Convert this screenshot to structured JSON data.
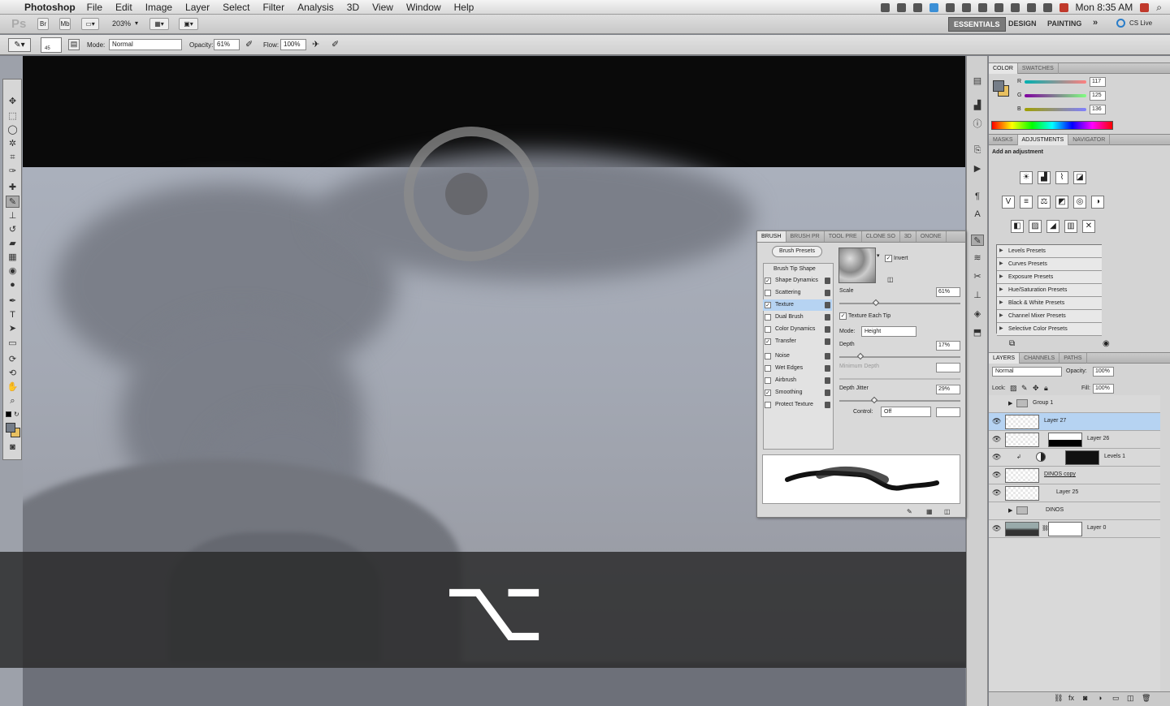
{
  "menubar": {
    "app": "Photoshop",
    "items": [
      "File",
      "Edit",
      "Image",
      "Layer",
      "Select",
      "Filter",
      "Analysis",
      "3D",
      "View",
      "Window",
      "Help"
    ],
    "clock": "Mon 8:35 AM"
  },
  "appbar": {
    "logo": "Ps",
    "br": "Br",
    "mb": "Mb",
    "zoom": "203%",
    "workspaces": [
      "ESSENTIALS",
      "DESIGN",
      "PAINTING"
    ],
    "more": "»",
    "cslive": "CS Live"
  },
  "options": {
    "brush_size": "45",
    "mode_label": "Mode:",
    "mode_value": "Normal",
    "opacity_label": "Opacity:",
    "opacity_value": "61%",
    "flow_label": "Flow:",
    "flow_value": "100%"
  },
  "key_overlay": {
    "glyph": "⌥"
  },
  "color_panel": {
    "tabs": [
      "COLOR",
      "SWATCHES"
    ],
    "r_label": "R",
    "r_value": "117",
    "g_label": "G",
    "g_value": "125",
    "b_label": "B",
    "b_value": "136",
    "fg_color": "#757d88",
    "bg_color": "#e8c060"
  },
  "adjustments_panel": {
    "tabs": [
      "MASKS",
      "ADJUSTMENTS",
      "NAVIGATOR"
    ],
    "title": "Add an adjustment",
    "presets": [
      "Levels Presets",
      "Curves Presets",
      "Exposure Presets",
      "Hue/Saturation Presets",
      "Black & White Presets",
      "Channel Mixer Presets",
      "Selective Color Presets"
    ]
  },
  "layers_panel": {
    "tabs": [
      "LAYERS",
      "CHANNELS",
      "PATHS"
    ],
    "blend": "Normal",
    "opacity_label": "Opacity:",
    "opacity": "100%",
    "lock_label": "Lock:",
    "fill_label": "Fill:",
    "fill": "100%",
    "layers": [
      {
        "name": "Group 1"
      },
      {
        "name": "Layer 27"
      },
      {
        "name": "Layer 26"
      },
      {
        "name": "Levels 1"
      },
      {
        "name": "DINOS copy"
      },
      {
        "name": "Layer 25"
      },
      {
        "name": "DINOS"
      },
      {
        "name": "Layer 0"
      }
    ]
  },
  "brush_panel": {
    "tabs": [
      "BRUSH",
      "BRUSH PR",
      "TOOL PRE",
      "CLONE SO",
      "3D",
      "ONONE"
    ],
    "presets_button": "Brush Presets",
    "section_header": "Brush Tip Shape",
    "options": [
      {
        "label": "Shape Dynamics",
        "checked": true
      },
      {
        "label": "Scattering",
        "checked": false
      },
      {
        "label": "Texture",
        "checked": true
      },
      {
        "label": "Dual Brush",
        "checked": false
      },
      {
        "label": "Color Dynamics",
        "checked": false
      },
      {
        "label": "Transfer",
        "checked": true
      },
      {
        "label": "Noise",
        "checked": false
      },
      {
        "label": "Wet Edges",
        "checked": false
      },
      {
        "label": "Airbrush",
        "checked": false
      },
      {
        "label": "Smoothing",
        "checked": true
      },
      {
        "label": "Protect Texture",
        "checked": false
      }
    ],
    "invert_label": "Invert",
    "scale_label": "Scale",
    "scale_value": "61%",
    "texture_each_tip": "Texture Each Tip",
    "mode_label": "Mode:",
    "mode_value": "Height",
    "depth_label": "Depth",
    "depth_value": "17%",
    "min_depth_label": "Minimum Depth",
    "depth_jitter_label": "Depth Jitter",
    "depth_jitter_value": "29%",
    "control_label": "Control:",
    "control_value": "Off"
  }
}
